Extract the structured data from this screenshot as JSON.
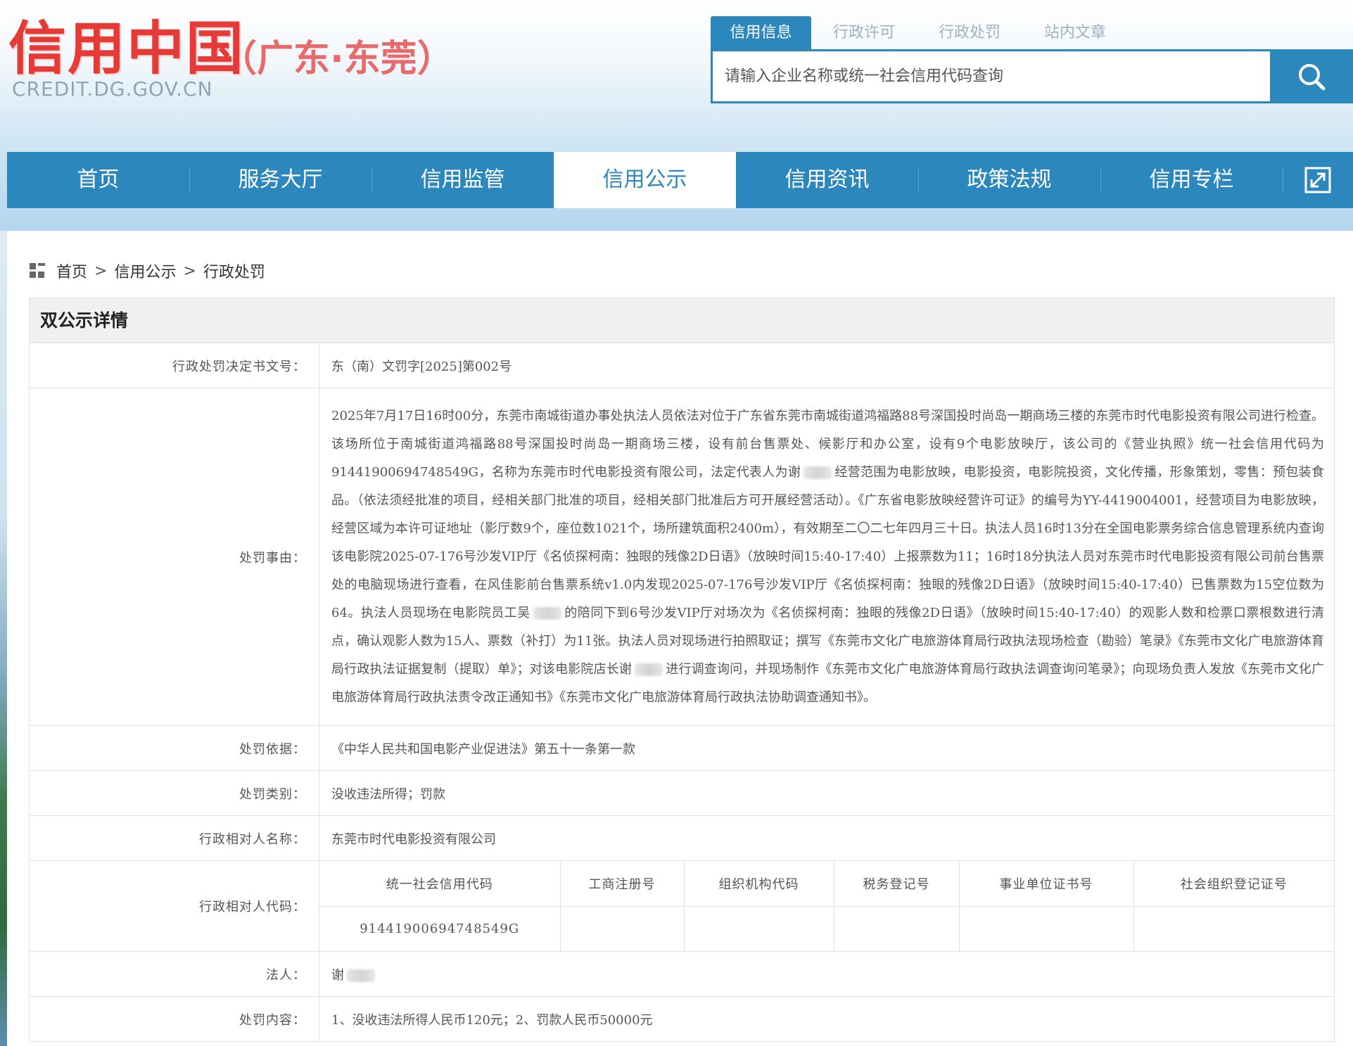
{
  "header": {
    "logo_main": "信用中国",
    "logo_region": "（广东·东莞）",
    "logo_url": "CREDIT.DG.GOV.CN"
  },
  "search": {
    "tabs": [
      {
        "label": "信用信息",
        "active": true
      },
      {
        "label": "行政许可",
        "active": false
      },
      {
        "label": "行政处罚",
        "active": false
      },
      {
        "label": "站内文章",
        "active": false
      }
    ],
    "placeholder": "请输入企业名称或统一社会信用代码查询",
    "button_icon": "search-icon"
  },
  "nav": {
    "items": [
      {
        "label": "首页",
        "active": false
      },
      {
        "label": "服务大厅",
        "active": false
      },
      {
        "label": "信用监管",
        "active": false
      },
      {
        "label": "信用公示",
        "active": true
      },
      {
        "label": "信用资讯",
        "active": false
      },
      {
        "label": "政策法规",
        "active": false
      },
      {
        "label": "信用专栏",
        "active": false
      }
    ],
    "expand_icon": "expand-icon"
  },
  "breadcrumb": {
    "icon": "grid-icon",
    "items": [
      "首页",
      "信用公示",
      "行政处罚"
    ],
    "separator": ">"
  },
  "detail": {
    "section_title": "双公示详情",
    "decision_no_label": "行政处罚决定书文号：",
    "decision_no": "东（南）文罚字[2025]第002号",
    "reason_label": "处罚事由：",
    "reason_parts": [
      "2025年7月17日16时00分，东莞市南城街道办事处执法人员依法对位于广东省东莞市南城街道鸿福路88号深国投时尚岛一期商场三楼的东莞市时代电影投资有限公司进行检查。该场所位于南城街道鸿福路88号深国投时尚岛一期商场三楼，设有前台售票处、候影厅和办公室，设有9个电影放映厅，该公司的《营业执照》统一社会信用代码为91441900694748549G，名称为东莞市时代电影投资有限公司，法定代表人为谢",
      "经营范围为电影放映，电影投资，电影院投资，文化传播，形象策划，零售：预包装食品。（依法须经批准的项目，经相关部门批准的项目，经相关部门批准后方可开展经营活动）。《广东省电影放映经营许可证》的编号为YY-4419004001，经营项目为电影放映，经营区域为本许可证地址（影厅数9个，座位数1021个，场所建筑面积2400m），有效期至二〇二七年四月三十日。执法人员16时13分在全国电影票务综合信息管理系统内查询该电影院2025-07-176号沙发VIP厅《名侦探柯南：独眼的残像2D日语》（放映时间15:40-17:40）上报票数为11；16时18分执法人员对东莞市时代电影投资有限公司前台售票处的电脑现场进行查看，在风佳影前台售票系统v1.0内发现2025-07-176号沙发VIP厅《名侦探柯南：独眼的残像2D日语》（放映时间15:40-17:40）已售票数为15空位数为64。执法人员现场在电影院员工吴",
      "的陪同下到6号沙发VIP厅对场次为《名侦探柯南：独眼的残像2D日语》（放映时间15:40-17:40）的观影人数和检票口票根数进行清点，确认观影人数为15人、票数（补打）为11张。执法人员对现场进行拍照取证；撰写《东莞市文化广电旅游体育局行政执法现场检查（勘验）笔录》《东莞市文化广电旅游体育局行政执法证据复制（提取）单》；对该电影院店长谢",
      "进行调查询问，并现场制作《东莞市文化广电旅游体育局行政执法调查询问笔录》；向现场负责人发放《东莞市文化广电旅游体育局行政执法责令改正通知书》《东莞市文化广电旅游体育局行政执法协助调查通知书》。"
    ],
    "basis_label": "处罚依据：",
    "basis": "《中华人民共和国电影产业促进法》第五十一条第一款",
    "category_label": "处罚类别：",
    "category": "没收违法所得；罚款",
    "party_name_label": "行政相对人名称：",
    "party_name": "东莞市时代电影投资有限公司",
    "party_code_label": "行政相对人代码：",
    "code_headers": [
      "统一社会信用代码",
      "工商注册号",
      "组织机构代码",
      "税务登记号",
      "事业单位证书号",
      "社会组织登记证号"
    ],
    "code_values": [
      "91441900694748549G",
      "",
      "",
      "",
      "",
      ""
    ],
    "legal_person_label": "法人：",
    "legal_person": "谢",
    "content_label": "处罚内容：",
    "content": "1、没收违法所得人民币120元；2、罚款人民币50000元"
  },
  "colors": {
    "brand_blue": "#2c87bd",
    "logo_red": "#e53a36",
    "header_bg": "#b9d7ea"
  }
}
